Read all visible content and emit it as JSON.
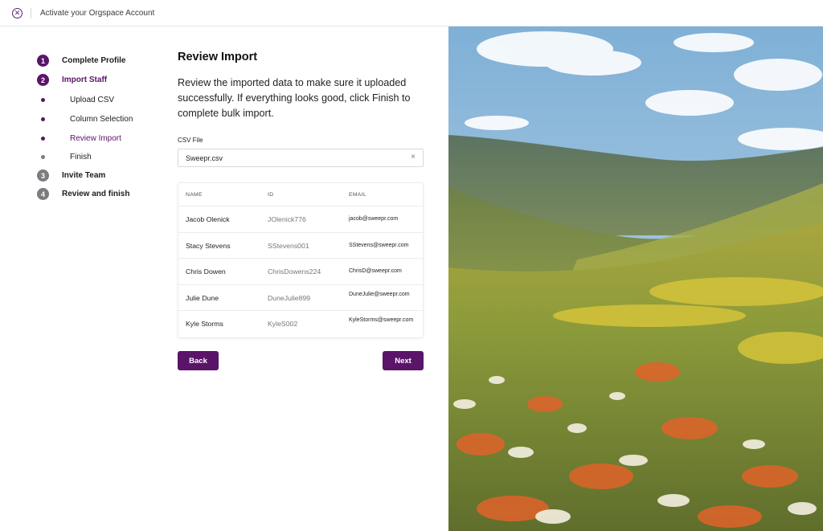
{
  "header": {
    "title": "Activate your Orgspace Account",
    "close_icon": "close-circle-icon"
  },
  "stepper": {
    "steps": [
      {
        "number": "1",
        "label": "Complete Profile"
      },
      {
        "number": "2",
        "label": "Import Staff"
      },
      {
        "number": "3",
        "label": "Invite Team"
      },
      {
        "number": "4",
        "label": "Review and finish"
      }
    ],
    "substeps": [
      {
        "label": "Upload CSV"
      },
      {
        "label": "Column Selection"
      },
      {
        "label": "Review Import"
      },
      {
        "label": "Finish"
      }
    ]
  },
  "main": {
    "title": "Review Import",
    "description": "Review the imported data to make sure it uploaded successfully. If everything looks good, click Finish to complete bulk import.",
    "csv_label": "CSV File",
    "csv_value": "Sweepr.csv",
    "clear_glyph": "×",
    "table": {
      "headers": [
        "NAME",
        "ID",
        "EMAIL"
      ],
      "rows": [
        {
          "name": "Jacob Olenick",
          "id": "JOlenick776",
          "email": "jacob@sweepr.com"
        },
        {
          "name": "Stacy Stevens",
          "id": "SStevens001",
          "email": "SStevens@sweepr.com"
        },
        {
          "name": "Chris Dowen",
          "id": "ChrisDowens224",
          "email": "ChrisD@sweepr.com"
        },
        {
          "name": "Julie Dune",
          "id": "DuneJulie899",
          "email": "DuneJulie@sweepr.com"
        },
        {
          "name": "Kyle Storms",
          "id": "KyleS002",
          "email": "KyleStorms@sweepr.com"
        }
      ]
    },
    "back_label": "Back",
    "next_label": "Next"
  },
  "colors": {
    "accent": "#5a1468",
    "muted": "#7b7b80"
  }
}
